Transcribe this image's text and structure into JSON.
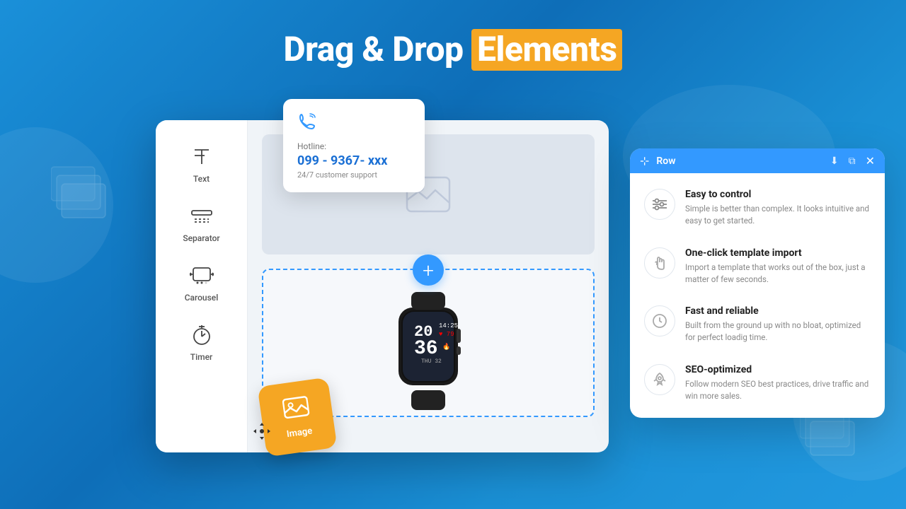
{
  "header": {
    "title_part1": "Drag & Drop ",
    "title_highlight": "Elements"
  },
  "hotline_card": {
    "label": "Hotline:",
    "number": "099 - 9367- xxx",
    "support": "24/7 customer support"
  },
  "sidebar": {
    "items": [
      {
        "id": "text",
        "label": "Text",
        "icon": "T"
      },
      {
        "id": "separator",
        "label": "Separator",
        "icon": "sep"
      },
      {
        "id": "carousel",
        "label": "Carousel",
        "icon": "car"
      },
      {
        "id": "timer",
        "label": "Timer",
        "icon": "tim"
      }
    ]
  },
  "image_drag": {
    "label": "Image"
  },
  "features_panel": {
    "toolbar": {
      "label": "Row"
    },
    "items": [
      {
        "id": "easy",
        "title": "Easy to control",
        "desc": "Simple is better than complex. It looks intuitive and easy to get started.",
        "icon": "sliders"
      },
      {
        "id": "template",
        "title": "One-click template import",
        "desc": "Import a template that works out of the box, just a matter of few seconds.",
        "icon": "hand"
      },
      {
        "id": "fast",
        "title": "Fast and reliable",
        "desc": "Built from the ground up with no bloat, optimized for perfect loadig time.",
        "icon": "clock"
      },
      {
        "id": "seo",
        "title": "SEO-optimized",
        "desc": "Follow modern SEO best practices, drive traffic and win more sales.",
        "icon": "rocket"
      }
    ]
  }
}
